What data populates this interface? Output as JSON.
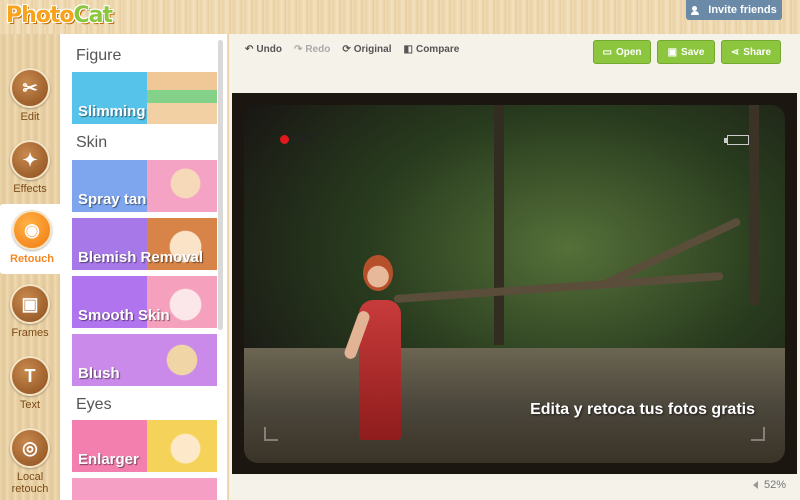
{
  "app": {
    "logo_main": "Photo",
    "logo_accent": "Cat",
    "invite_label": "Invite friends"
  },
  "rail": {
    "items": [
      {
        "label": "Edit",
        "icon": "scissors-icon",
        "glyph": "✂",
        "active": false
      },
      {
        "label": "Effects",
        "icon": "magic-wand-icon",
        "glyph": "✦",
        "active": false
      },
      {
        "label": "Retouch",
        "icon": "retouch-face-icon",
        "glyph": "◉",
        "active": true
      },
      {
        "label": "Frames",
        "icon": "frame-icon",
        "glyph": "▣",
        "active": false
      },
      {
        "label": "Text",
        "icon": "text-icon",
        "glyph": "T",
        "active": false
      },
      {
        "label": "Local retouch",
        "icon": "local-retouch-icon",
        "glyph": "◎",
        "active": false
      }
    ]
  },
  "panel": {
    "categories": {
      "figure": "Figure",
      "skin": "Skin",
      "eyes": "Eyes"
    },
    "cards": {
      "slimming": {
        "label": "Slimming",
        "color": "#56c3ea"
      },
      "spray_tan": {
        "label": "Spray tan",
        "color": "#7ea6ef"
      },
      "blemish": {
        "label": "Blemish Removal",
        "color": "#a779e8"
      },
      "smooth": {
        "label": "Smooth Skin",
        "color": "#b174ef"
      },
      "blush": {
        "label": "Blush",
        "color": "#c98ae9"
      },
      "enlarger": {
        "label": "Enlarger",
        "color": "#f27fae"
      }
    }
  },
  "toolbar": {
    "undo": "Undo",
    "redo": "Redo",
    "original": "Original",
    "compare": "Compare",
    "open": "Open",
    "save": "Save",
    "share": "Share"
  },
  "canvas": {
    "rec_label": "REC",
    "caption": "Edita y retoca tus fotos gratis",
    "zoom": "52%"
  },
  "colors": {
    "accent_green": "#8cc63f",
    "accent_orange": "#f5871f",
    "invite_blue": "#6a8aa8"
  }
}
